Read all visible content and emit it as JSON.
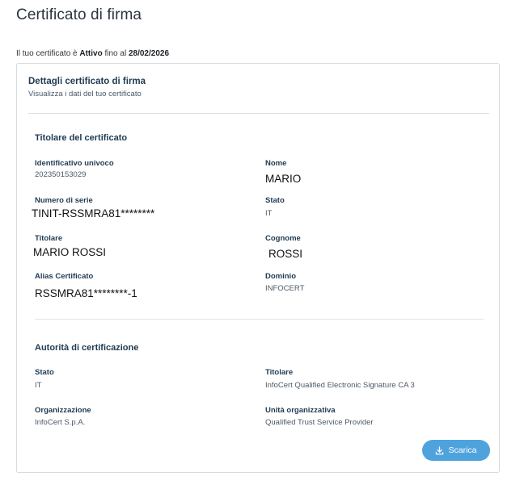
{
  "page": {
    "title": "Certificato di firma",
    "status": {
      "prefix": "Il tuo certificato è ",
      "state": "Attivo",
      "middle": " fino al ",
      "date": "28/02/2026"
    }
  },
  "card": {
    "title": "Dettagli certificato di firma",
    "subtitle": "Visualizza i dati del tuo certificato",
    "holder_section": {
      "title": "Titolare del certificato",
      "fields": {
        "unique_id_label": "Identificativo univoco",
        "unique_id_value": "202350153029",
        "name_label": "Nome",
        "name_value": "MARIO",
        "serial_label": "Numero di serie",
        "serial_value": "TINIT-RSSMRA81********",
        "state_label": "Stato",
        "state_value": "IT",
        "holder_label": "Titolare",
        "holder_value": "MARIO ROSSI",
        "surname_label": "Cognome",
        "surname_value": "ROSSI",
        "alias_label": "Alias Certificato",
        "alias_value": "RSSMRA81********-1",
        "domain_label": "Dominio",
        "domain_value": "INFOCERT"
      }
    },
    "authority_section": {
      "title": "Autorità di certificazione",
      "fields": {
        "state_label": "Stato",
        "state_value": "IT",
        "holder_label": "Titolare",
        "holder_value": "InfoCert Qualified Electronic Signature CA 3",
        "org_label": "Organizzazione",
        "org_value": "InfoCert S.p.A.",
        "unit_label": "Unità organizzativa",
        "unit_value": "Qualified Trust Service Provider"
      }
    },
    "download_label": "Scarica",
    "download_icon": "download-icon"
  },
  "colors": {
    "accent": "#4fa3dd",
    "heading": "#1f3a52",
    "border": "#d6dbe1"
  }
}
